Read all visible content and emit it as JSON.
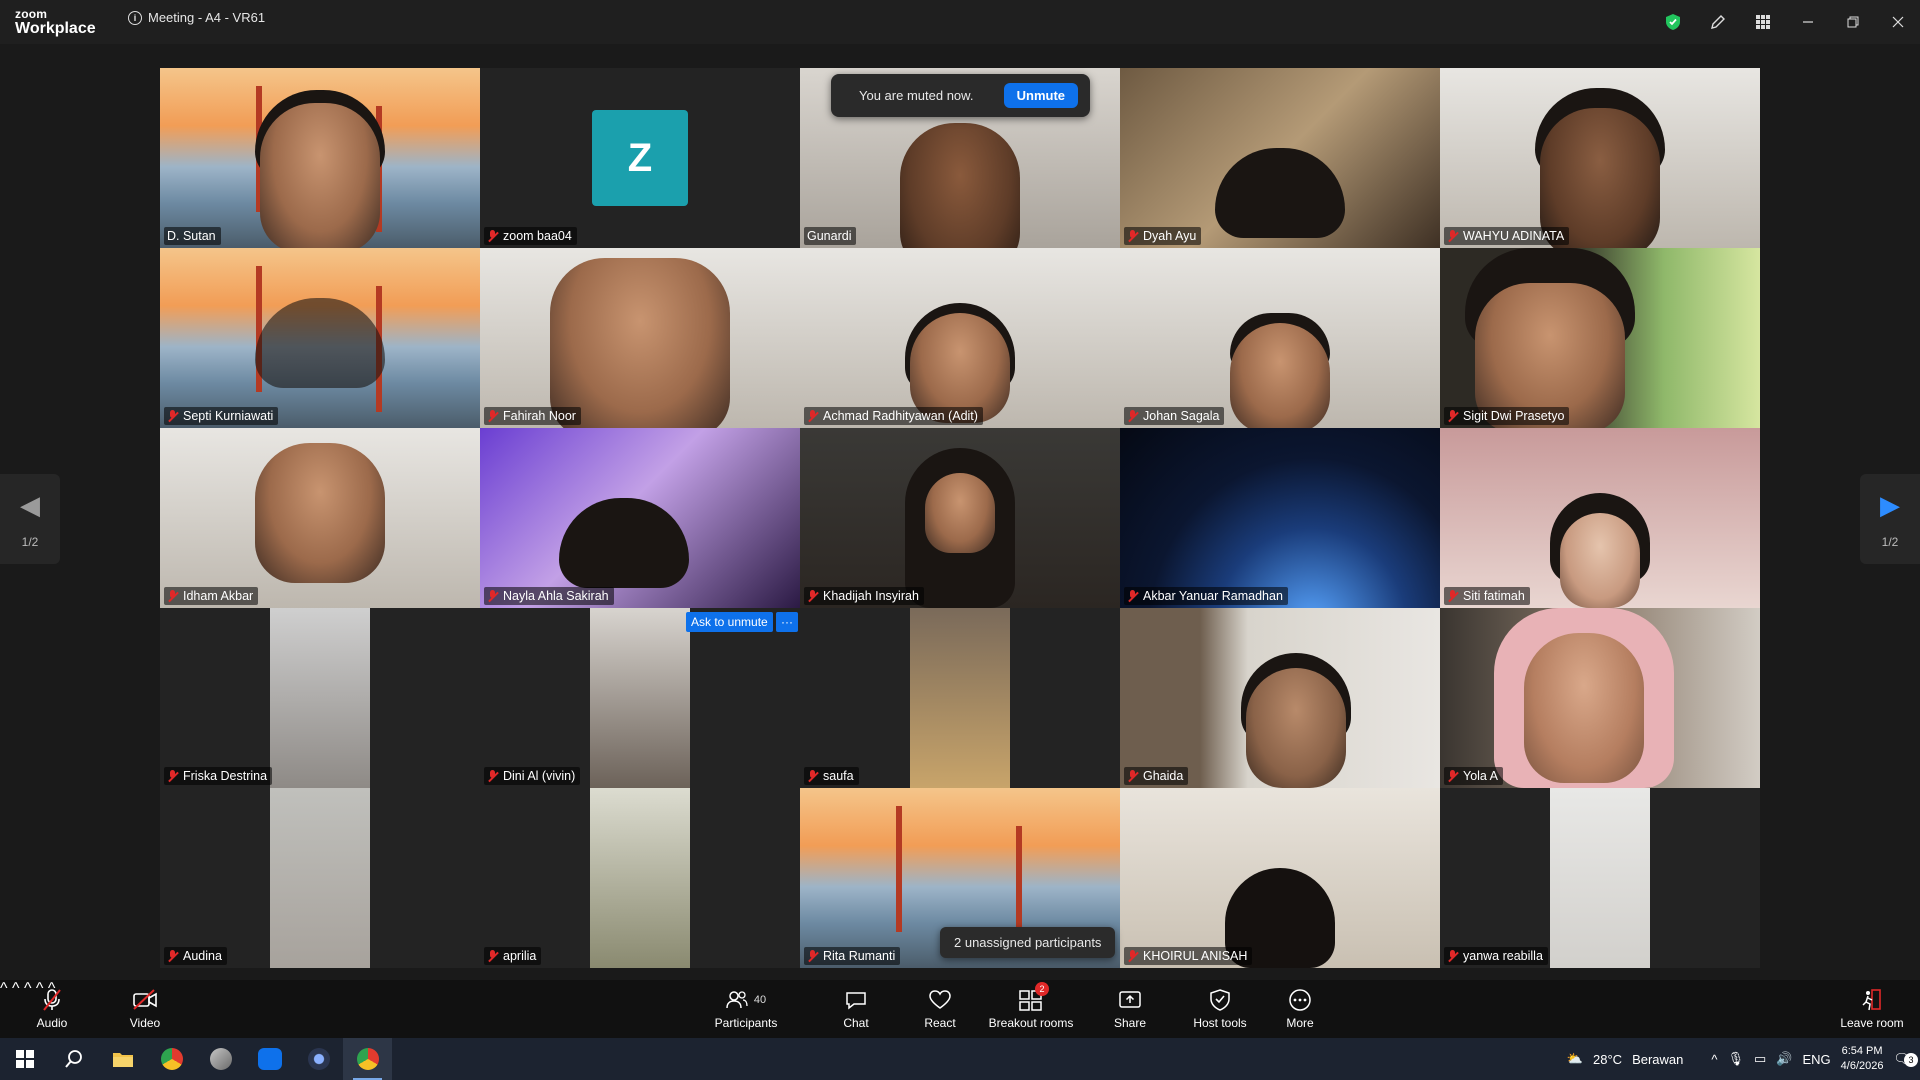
{
  "window": {
    "logo_line1": "zoom",
    "logo_line2": "Workplace",
    "meeting_title": "Meeting - A4 - VR61",
    "info_icon": "i"
  },
  "toast": {
    "message": "You are muted now.",
    "button": "Unmute"
  },
  "tiles": [
    {
      "name": "D. Sutan",
      "muted": false
    },
    {
      "name": "zoom baa04",
      "muted": true,
      "avatar": "Z"
    },
    {
      "name": "Gunardi",
      "muted": false
    },
    {
      "name": "Dyah Ayu",
      "muted": true
    },
    {
      "name": "WAHYU ADINATA",
      "muted": true
    },
    {
      "name": "Septi Kurniawati",
      "muted": true
    },
    {
      "name": "Fahirah Noor",
      "muted": true
    },
    {
      "name": "Achmad Radhityawan (Adit)",
      "muted": true
    },
    {
      "name": "Johan Sagala",
      "muted": true
    },
    {
      "name": "Sigit Dwi Prasetyo",
      "muted": true
    },
    {
      "name": "Idham Akbar",
      "muted": true
    },
    {
      "name": "Nayla Ahla Sakirah",
      "muted": true
    },
    {
      "name": "Khadijah Insyirah",
      "muted": true
    },
    {
      "name": "Akbar Yanuar Ramadhan",
      "muted": true
    },
    {
      "name": "Siti fatimah",
      "muted": true
    },
    {
      "name": "Friska Destrina",
      "muted": true
    },
    {
      "name": "Dini Al (vivin)",
      "muted": true
    },
    {
      "name": "saufa",
      "muted": true
    },
    {
      "name": "Ghaida",
      "muted": true
    },
    {
      "name": "Yola A",
      "muted": true
    },
    {
      "name": "Audina",
      "muted": true
    },
    {
      "name": "aprilia",
      "muted": true
    },
    {
      "name": "Rita Rumanti",
      "muted": true
    },
    {
      "name": "KHOIRUL ANISAH",
      "muted": true
    },
    {
      "name": "yanwa reabilla",
      "muted": true
    }
  ],
  "tile_actions": {
    "ask_to_unmute": "Ask to unmute",
    "more": "···"
  },
  "unassigned": "2 unassigned participants",
  "pagination": {
    "left_label": "1/2",
    "right_label": "1/2"
  },
  "toolbar": {
    "audio": "Audio",
    "video": "Video",
    "participants": "Participants",
    "participants_count": "40",
    "chat": "Chat",
    "react": "React",
    "breakout": "Breakout rooms",
    "breakout_badge": "2",
    "share": "Share",
    "host_tools": "Host tools",
    "more": "More",
    "leave": "Leave room"
  },
  "taskbar": {
    "weather_temp": "28°C",
    "weather_text": "Berawan",
    "lang": "ENG",
    "time": "6:54 PM",
    "date": "4/6/2026",
    "notif_count": "3"
  },
  "colors": {
    "accent": "#0e71eb",
    "speaking": "#22c58b",
    "muted": "#e02828"
  }
}
